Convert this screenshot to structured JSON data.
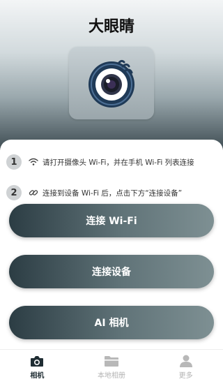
{
  "header": {
    "title": "大眼睛",
    "logo_icon": "eye-camera-icon"
  },
  "steps": [
    {
      "number": "1",
      "icon": "wifi-icon",
      "text": "请打开摄像头 Wi-Fi，并在手机 Wi-Fi 列表连接"
    },
    {
      "number": "2",
      "icon": "link-icon",
      "text": "连接到设备 Wi-Fi 后，点击下方“连接设备”"
    }
  ],
  "buttons": {
    "connect_wifi": "连接 Wi-Fi",
    "connect_device": "连接设备",
    "ai_camera": "AI 相机"
  },
  "tabbar": {
    "items": [
      {
        "label": "相机",
        "icon": "camera-icon",
        "active": true
      },
      {
        "label": "本地相册",
        "icon": "folder-icon",
        "active": false
      },
      {
        "label": "更多",
        "icon": "person-icon",
        "active": false
      }
    ]
  },
  "colors": {
    "accent_dark": "#2c3d44",
    "accent_light": "#7e9093",
    "inactive": "#b3b3b3"
  }
}
